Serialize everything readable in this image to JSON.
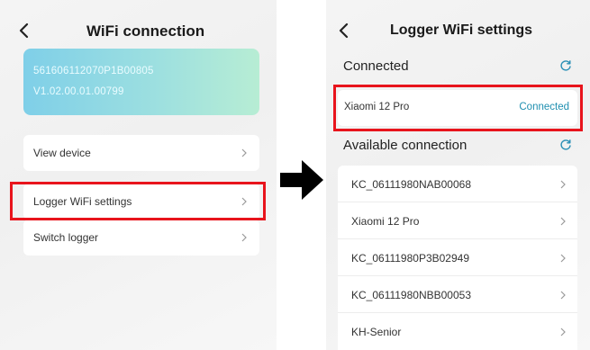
{
  "left_screen": {
    "title": "WiFi connection",
    "device": {
      "serial": "561606112070P1B00805",
      "version": "V1.02.00.01.00799"
    },
    "menu": [
      {
        "label": "View device"
      },
      {
        "label": "Logger WiFi settings"
      },
      {
        "label": "Switch logger"
      }
    ]
  },
  "right_screen": {
    "title": "Logger WiFi settings",
    "connected_section": {
      "heading": "Connected",
      "network": "Xiaomi 12 Pro",
      "status": "Connected"
    },
    "available_section": {
      "heading": "Available connection",
      "networks": [
        {
          "name": "KC_06111980NAB00068"
        },
        {
          "name": "Xiaomi 12 Pro"
        },
        {
          "name": "KC_06111980P3B02949"
        },
        {
          "name": "KC_06111980NBB00053"
        },
        {
          "name": "KH-Senior"
        }
      ]
    }
  },
  "colors": {
    "highlight": "#e8141c",
    "status_connected": "#1f8fb0",
    "card_gradient_start": "#7fcfe8",
    "card_gradient_end": "#b7edd4"
  },
  "icons": {
    "back": "back-chevron-icon",
    "chevron": "chevron-right-icon",
    "refresh": "refresh-icon",
    "arrow": "arrow-right-icon"
  }
}
